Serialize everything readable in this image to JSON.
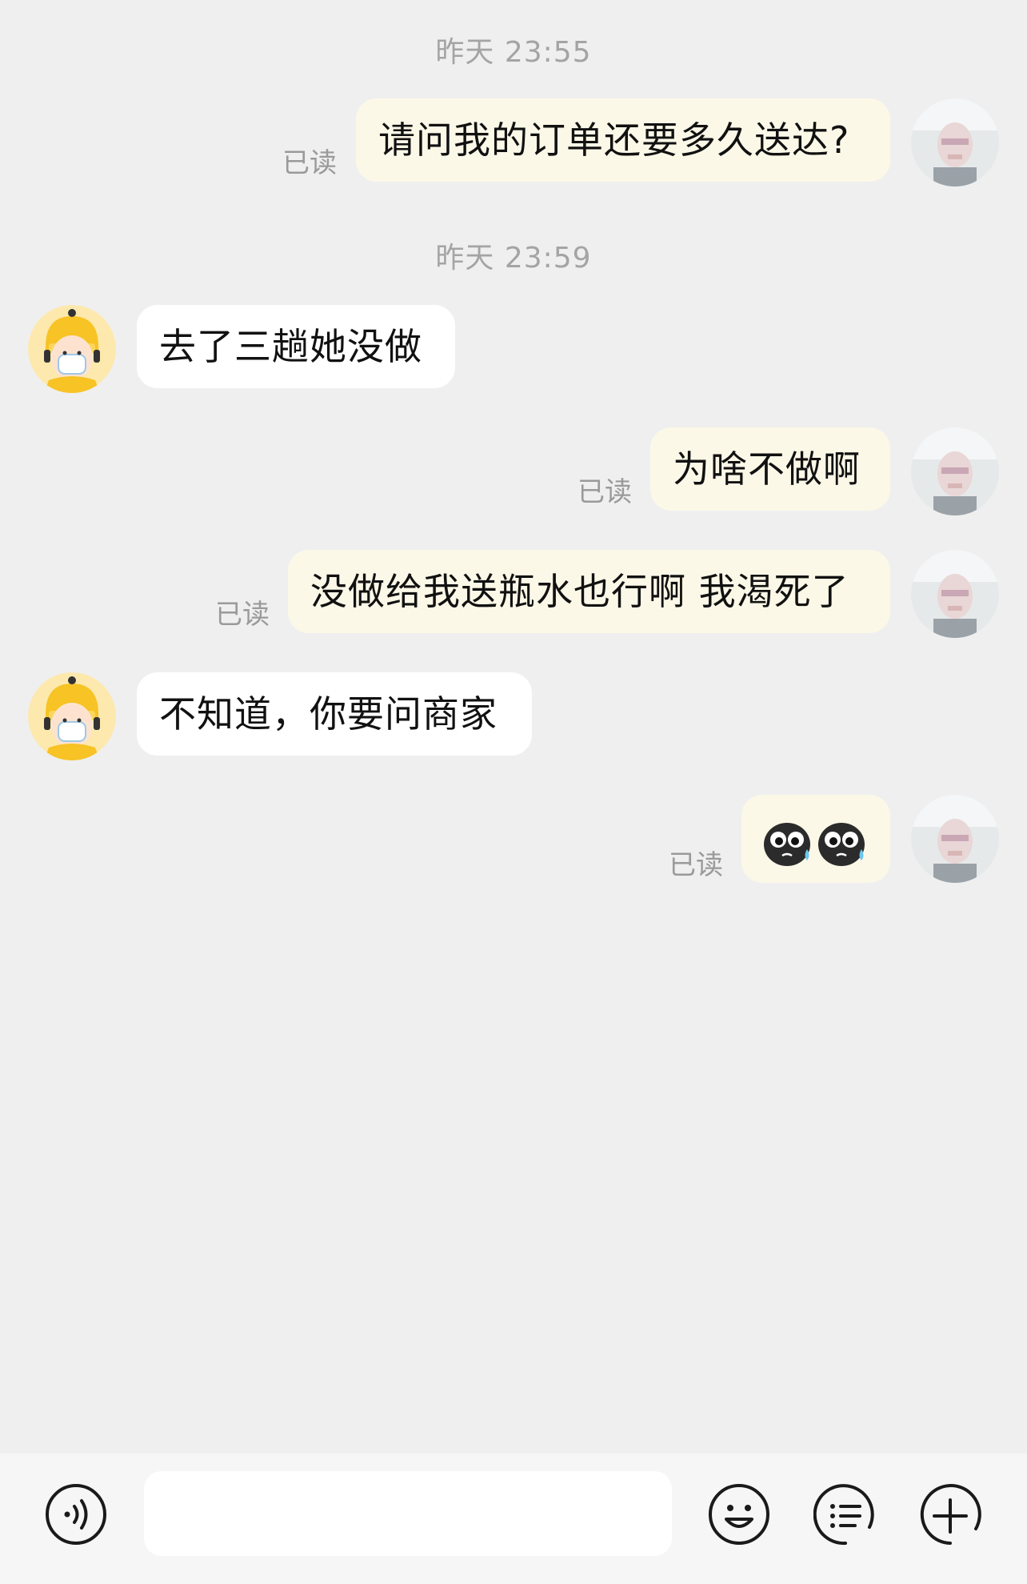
{
  "timestamps": [
    "昨天 23:55",
    "昨天 23:59"
  ],
  "read_label": "已读",
  "messages": [
    {
      "from": "me",
      "text": "请问我的订单还要多久送达?",
      "read": true
    },
    {
      "from": "courier",
      "text": "去了三趟她没做"
    },
    {
      "from": "me",
      "text": "为啥不做啊",
      "read": true
    },
    {
      "from": "me",
      "text": "没做给我送瓶水也行啊 我渴死了",
      "read": true
    },
    {
      "from": "courier",
      "text": "不知道，你要问商家"
    },
    {
      "from": "me",
      "text": "",
      "emoji": [
        "crying-face-icon",
        "crying-face-icon"
      ],
      "read": true
    }
  ],
  "input": {
    "value": "",
    "placeholder": ""
  },
  "toolbar": {
    "icons": [
      "voice-icon",
      "emoji-icon",
      "quick-reply-icon",
      "plus-icon"
    ]
  },
  "colors": {
    "background": "#efefef",
    "my_bubble": "#fcf8e8",
    "their_bubble": "#ffffff",
    "timestamp_text": "#a4a4a4",
    "read_text": "#9a9a9a"
  }
}
